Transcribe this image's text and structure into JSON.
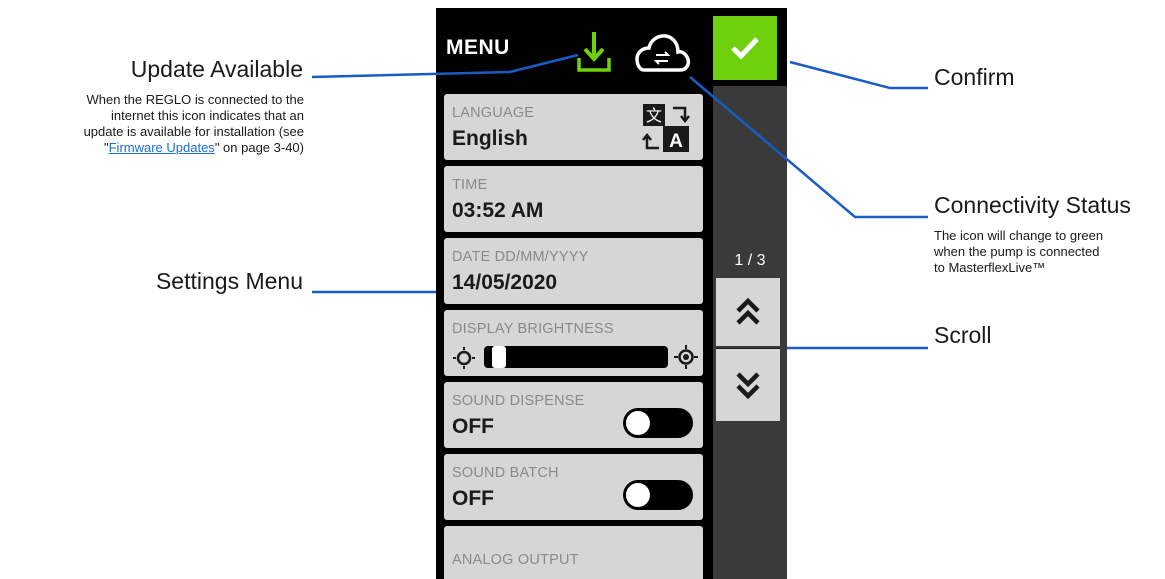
{
  "device": {
    "menu_title": "MENU",
    "page_indicator": "1 / 3",
    "cards": {
      "language": {
        "label": "LANGUAGE",
        "value": "English"
      },
      "time": {
        "label": "TIME",
        "value": "03:52 AM"
      },
      "date": {
        "label": "DATE DD/MM/YYYY",
        "value": "14/05/2020"
      },
      "brightness": {
        "label": "DISPLAY BRIGHTNESS",
        "level": 0.03
      },
      "sound_dispense": {
        "label": "SOUND DISPENSE",
        "value": "OFF"
      },
      "sound_batch": {
        "label": "SOUND BATCH",
        "value": "OFF"
      },
      "analog_output": {
        "label": "ANALOG OUTPUT"
      }
    },
    "icons": {
      "update": "download-arrow-icon",
      "connectivity": "cloud-sync-icon",
      "confirm": "checkmark-icon",
      "language": "translate-icon",
      "scroll_up": "double-chevron-up-icon",
      "scroll_down": "double-chevron-down-icon",
      "brightness_low": "sun-low-icon",
      "brightness_high": "sun-high-icon"
    },
    "colors": {
      "confirm_green": "#6fd10e",
      "update_green": "#6fd10e",
      "card_gray": "#d6d6d6",
      "callout_blue": "#1a5bc4"
    }
  },
  "annotations": {
    "update_available": {
      "title": "Update Available",
      "desc_line1": "When the REGLO is connected to the",
      "desc_line2": "internet this icon indicates that an",
      "desc_line3": "update is available for installation (see",
      "desc_quote_open": "\"",
      "desc_link": "Firmware Updates",
      "desc_line4_rest": "\" on page 3-40)"
    },
    "settings_menu": {
      "title": "Settings Menu"
    },
    "confirm": {
      "title": "Confirm"
    },
    "connectivity_status": {
      "title": "Connectivity Status",
      "desc_line1": "The icon will change to green",
      "desc_line2": "when the pump is connected",
      "desc_line3": "to MasterflexLive™"
    },
    "scroll": {
      "title": "Scroll"
    }
  }
}
